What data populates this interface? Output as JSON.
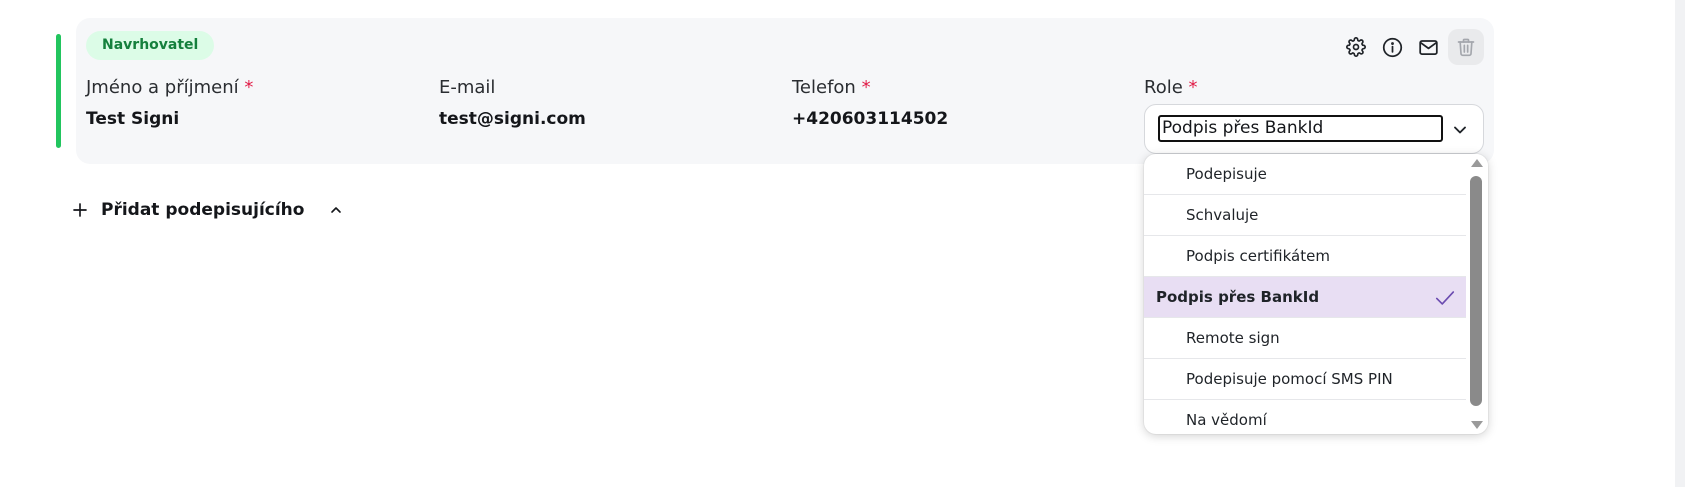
{
  "signer": {
    "badge": "Navrhovatel",
    "accent_color": "#22c55e",
    "name_label": "Jméno a příjmení",
    "name_value": "Test Signi",
    "email_label": "E-mail",
    "email_value": "test@signi.com",
    "phone_label": "Telefon",
    "phone_value": "+420603114502",
    "role_label": "Role",
    "required_mark": "*",
    "role_value": "Podpis přes BankId",
    "actions": [
      "gear-icon",
      "info-icon",
      "mail-icon",
      "trash-icon"
    ]
  },
  "role_options": [
    {
      "label": "Podepisuje",
      "selected": false
    },
    {
      "label": "Schvaluje",
      "selected": false
    },
    {
      "label": "Podpis certifikátem",
      "selected": false
    },
    {
      "label": "Podpis přes BankId",
      "selected": true
    },
    {
      "label": "Remote sign",
      "selected": false
    },
    {
      "label": "Podepisuje pomocí SMS PIN",
      "selected": false
    },
    {
      "label": "Na vědomí",
      "selected": false
    }
  ],
  "add_signer": {
    "label": "Přidat podepisujícího",
    "icon": "plus-icon",
    "toggle_icon": "chevron-up-icon"
  },
  "colors": {
    "selected_option_bg": "#e8def3",
    "check_color": "#6b4bb0",
    "required_color": "#e11d48"
  }
}
